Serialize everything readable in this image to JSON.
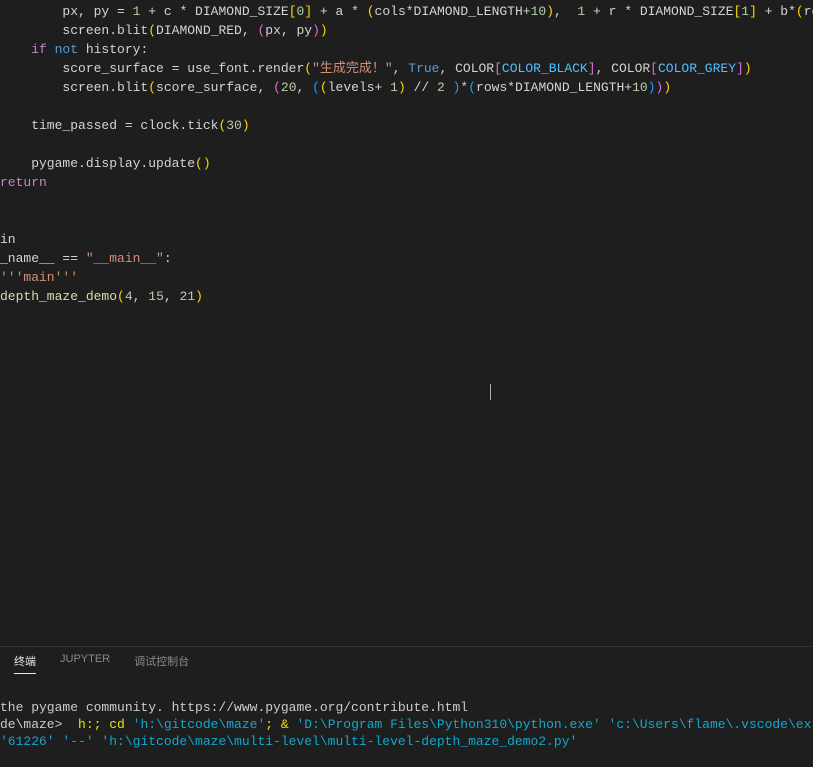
{
  "code": {
    "l1a": "        px, py ",
    "l1b": "= ",
    "l1c": "1",
    "l1d": " + c * DIAMOND_SIZE",
    "l1e": "[",
    "l1f": "0",
    "l1g": "]",
    "l1h": " + a * ",
    "l1i": "(",
    "l1j": "cols*DIAMOND_LENGTH+",
    "l1k": "10",
    "l1l": ")",
    "l1m": ",  ",
    "l1n": "1",
    "l1o": " + r * DIAMOND_SIZE",
    "l1p": "[",
    "l1q": "1",
    "l1r": "]",
    "l1s": " + b*",
    "l1t": "(",
    "l1u": "row",
    "l2a": "        screen.blit",
    "l2b": "(",
    "l2c": "DIAMOND_RED, ",
    "l2d": "(",
    "l2e": "px, py",
    "l2f": ")",
    "l2g": ")",
    "l3a": "    if",
    "l3b": " not",
    "l3c": " history:",
    "l4a": "        score_surface = use_font.render",
    "l4b": "(",
    "l4c": "\"生成完成！\"",
    "l4d": ", ",
    "l4e": "True",
    "l4f": ", COLOR",
    "l4g": "[",
    "l4h": "COLOR_BLACK",
    "l4i": "]",
    "l4j": ", COLOR",
    "l4k": "[",
    "l4l": "COLOR_GREY",
    "l4m": "]",
    "l4n": ")",
    "l5a": "        screen.blit",
    "l5b": "(",
    "l5c": "score_surface, ",
    "l5d": "(",
    "l5e": "20",
    "l5f": ", ",
    "l5g": "(",
    "l5h": "(",
    "l5i": "levels+ ",
    "l5j": "1",
    "l5k": ")",
    "l5l": " // ",
    "l5m": "2",
    "l5n": " )",
    "l5o": "*",
    "l5p": "(",
    "l5q": "rows*DIAMOND_LENGTH+",
    "l5r": "10",
    "l5s": ")",
    "l5t": ")",
    "l5u": ")",
    "l6a": "    time_passed = clock.tick",
    "l6b": "(",
    "l6c": "30",
    "l6d": ")",
    "l7a": "    pygame.display.update",
    "l7b": "()",
    "l8a": "return",
    "l9a": "in",
    "l10a": "_name__ == ",
    "l10b": "\"__main__\"",
    "l10c": ":",
    "l11a": "'''main'''",
    "l12a": "depth_maze_demo",
    "l12b": "(",
    "l12c": "4",
    "l12d": ", ",
    "l12e": "15",
    "l12f": ", ",
    "l12g": "21",
    "l12h": ")"
  },
  "tabs": {
    "terminal": "终端",
    "jupyter": "JUPYTER",
    "debug": "调试控制台"
  },
  "terminal": {
    "line1": "the pygame community. https://www.pygame.org/contribute.html",
    "prompt": "de\\maze> ",
    "cmd1": " h:; cd ",
    "path1": "'h:\\gitcode\\maze'",
    "cmd2": "; & ",
    "path2": "'D:\\Program Files\\Python310\\python.exe'",
    "space": " ",
    "path3": "'c:\\Users\\flame\\.vscode\\extensions\\ms-p",
    "line3a": "'61226'",
    "line3b": " '--' ",
    "line3c": "'h:\\gitcode\\maze\\multi-level\\multi-level-depth_maze_demo2.py'"
  }
}
